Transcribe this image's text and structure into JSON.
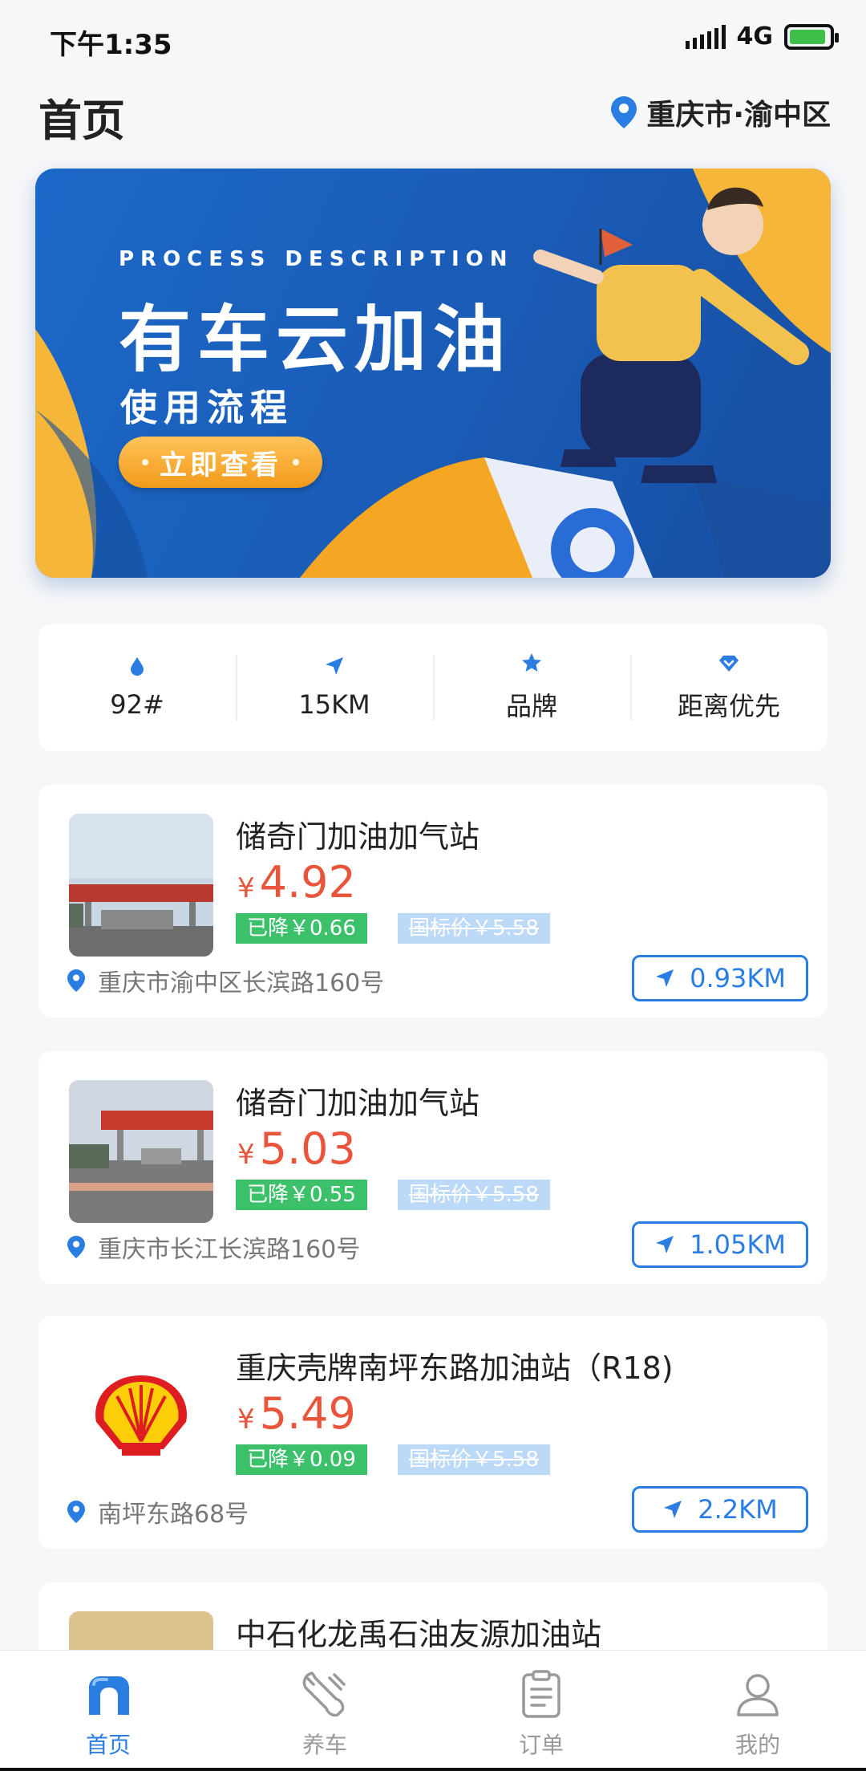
{
  "status_bar": {
    "time": "下午1:35",
    "network": "4G"
  },
  "header": {
    "title": "首页",
    "location": "重庆市·渝中区"
  },
  "banner": {
    "subtitle": "PROCESS DESCRIPTION",
    "title": "有车云加油",
    "description": "使用流程",
    "button_label": "立即查看"
  },
  "filters": [
    {
      "label": "92#",
      "icon": "drop-icon"
    },
    {
      "label": "15KM",
      "icon": "navigation-icon"
    },
    {
      "label": "品牌",
      "icon": "star-icon"
    },
    {
      "label": "距离优先",
      "icon": "diamond-icon"
    }
  ],
  "stations": [
    {
      "name": "储奇门加油加气站",
      "currency": "¥",
      "price": "4.92",
      "discount": "已降￥0.66",
      "standard_price": "国标价￥5.58",
      "address": "重庆市渝中区长滨路160号",
      "distance": "0.93KM"
    },
    {
      "name": "储奇门加油加气站",
      "currency": "¥",
      "price": "5.03",
      "discount": "已降￥0.55",
      "standard_price": "国标价￥5.58",
      "address": "重庆市长江长滨路160号",
      "distance": "1.05KM"
    },
    {
      "name": "重庆壳牌南坪东路加油站（R18)",
      "currency": "¥",
      "price": "5.49",
      "discount": "已降￥0.09",
      "standard_price": "国标价￥5.58",
      "address": "南坪东路68号",
      "distance": "2.2KM"
    },
    {
      "name": "中石化龙禹石油友源加油站"
    }
  ],
  "bottom_nav": [
    {
      "label": "首页",
      "icon": "home-icon",
      "active": true
    },
    {
      "label": "养车",
      "icon": "wrench-icon",
      "active": false
    },
    {
      "label": "订单",
      "icon": "clipboard-icon",
      "active": false
    },
    {
      "label": "我的",
      "icon": "user-icon",
      "active": false
    }
  ],
  "colors": {
    "accent": "#2a7de1",
    "price": "#e8553a",
    "discount": "#3cc06a",
    "standard_tag": "#bcd9f7",
    "banner": "#1c68c8",
    "banner_button": "#f29a1a"
  }
}
